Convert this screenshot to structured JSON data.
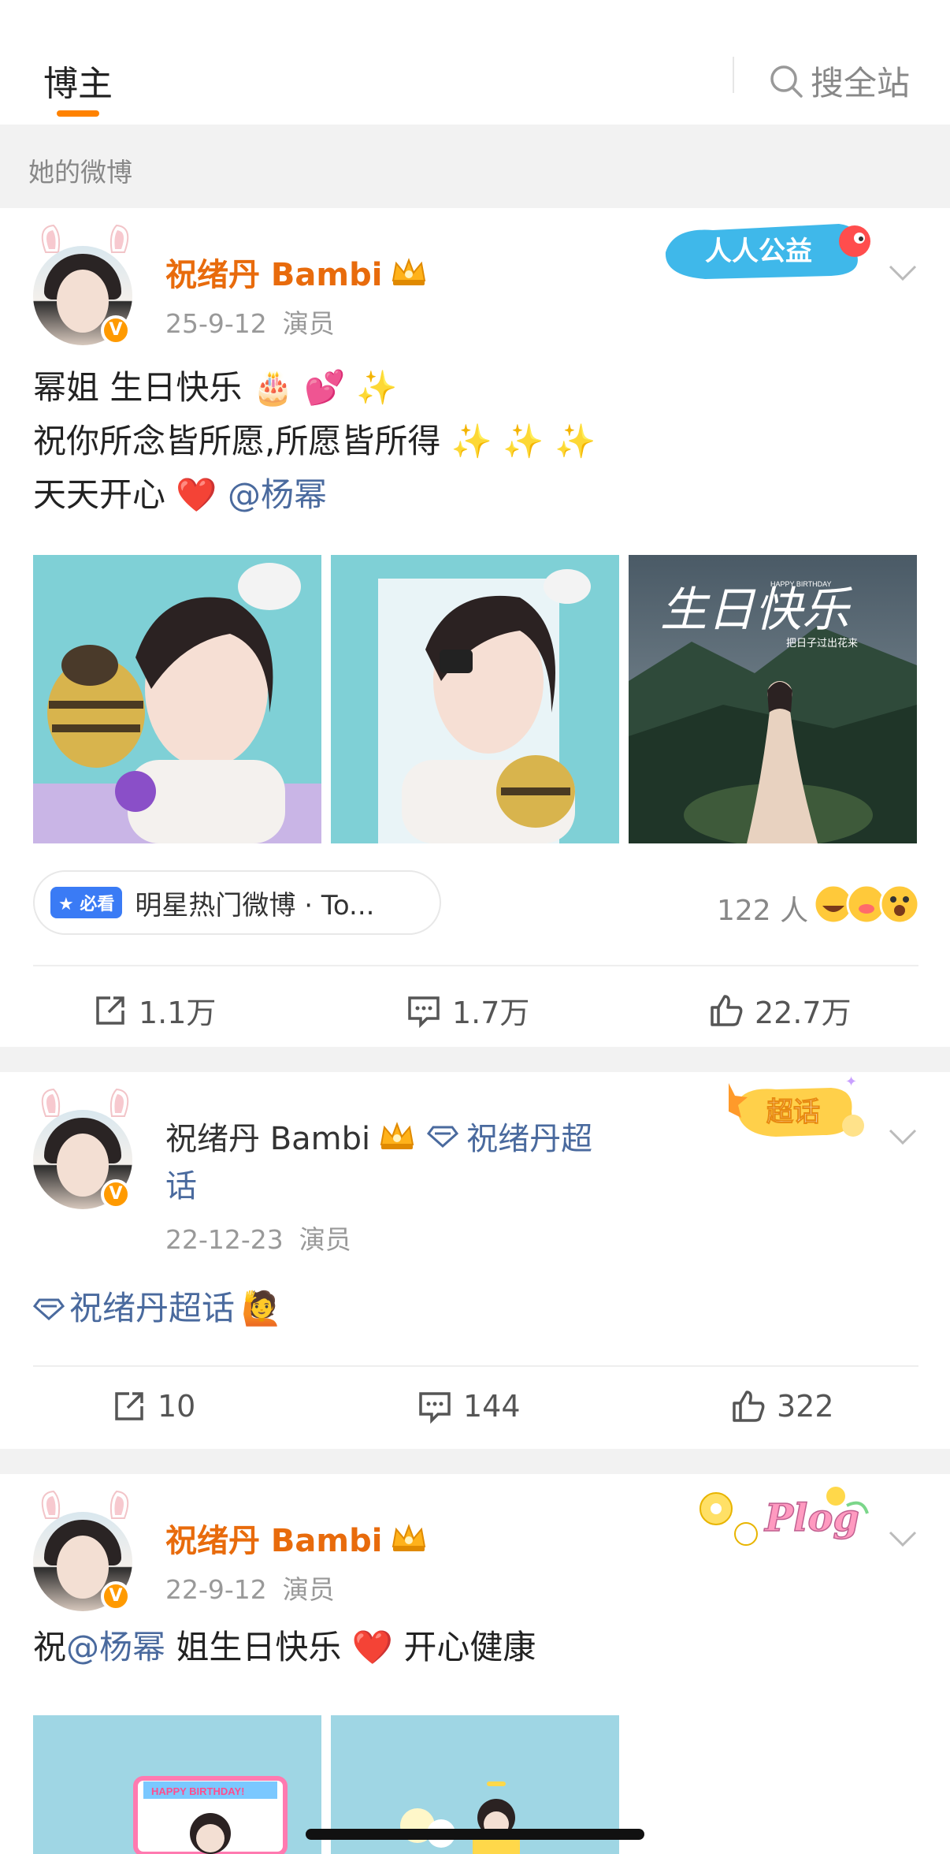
{
  "header": {
    "tab_label": "博主",
    "search_label": "搜全站"
  },
  "section": {
    "label": "她的微博"
  },
  "colors": {
    "accent": "#ff8200",
    "name_orange": "#e86b0c",
    "link_blue": "#4a6a9e"
  },
  "posts": [
    {
      "author": "祝绪丹 Bambi",
      "date": "25-9-12",
      "role": "演员",
      "lines": [
        "幂姐 生日快乐 🎂 💕 ✨",
        "祝你所念皆所愿,所愿皆所得 ✨ ✨ ✨",
        "天天开心 ❤️ "
      ],
      "mention": "@杨幂",
      "sticker": "人人公益",
      "hot_badge": "必看",
      "hot_text": "明星热门微博 · To...",
      "reaction_count": "122 人",
      "reposts": "1.1万",
      "comments": "1.7万",
      "likes": "22.7万",
      "image_caption": "生日快乐",
      "image_caption_small": "HAPPY BIRTHDAY",
      "image_caption_side": "把日子过出花来"
    },
    {
      "author": "祝绪丹 Bambi",
      "topic_inline_1": "祝绪丹超",
      "topic_inline_2": "话",
      "date": "22-12-23",
      "role": "演员",
      "topic": "祝绪丹超话",
      "sticker": "超话",
      "reposts": "10",
      "comments": "144",
      "likes": "322"
    },
    {
      "author": "祝绪丹 Bambi",
      "date": "22-9-12",
      "role": "演员",
      "prefix": "祝",
      "mention": "@杨幂",
      "suffix": " 姐生日快乐 ❤️ 开心健康",
      "sticker": "Plog",
      "image_banner": "HAPPY BIRTHDAY!"
    }
  ]
}
